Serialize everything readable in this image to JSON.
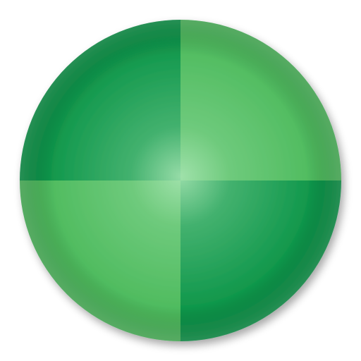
{
  "icon": {
    "name": "green-quartered-sphere-icon",
    "colors": {
      "dark_quadrant": "#0a9447",
      "light_quadrant": "#4cba5c",
      "center_highlight": "#aee8b8",
      "rim_shadow": "#7a8a7f"
    },
    "quadrants": [
      {
        "position": "top-left",
        "tone": "dark"
      },
      {
        "position": "top-right",
        "tone": "light"
      },
      {
        "position": "bottom-left",
        "tone": "light"
      },
      {
        "position": "bottom-right",
        "tone": "dark"
      }
    ]
  }
}
